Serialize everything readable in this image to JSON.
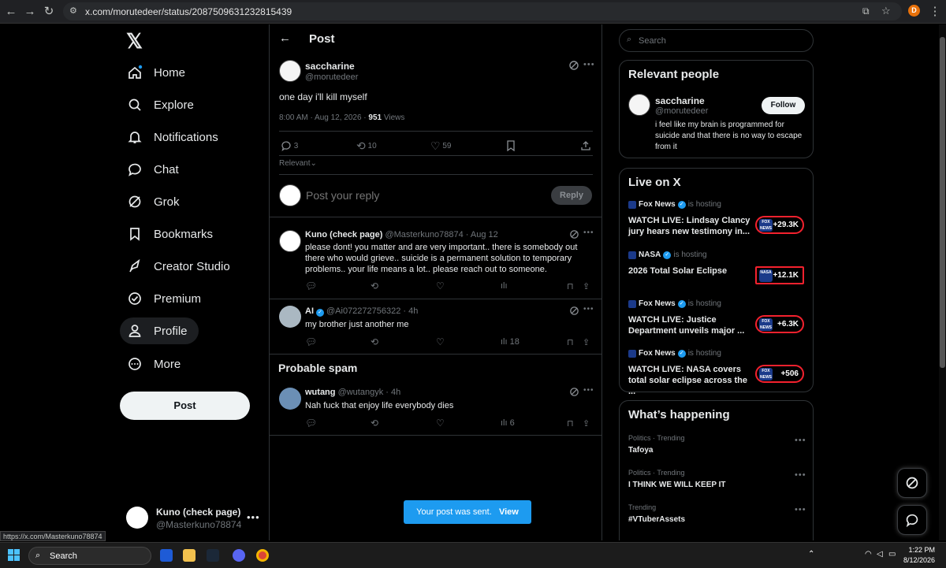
{
  "browser": {
    "url": "x.com/morutedeer/status/2087509631232815439",
    "profile_initial": "D",
    "status_url": "https://x.com/Masterkuno78874"
  },
  "nav": {
    "items": [
      {
        "label": "Home",
        "icon": "home-icon"
      },
      {
        "label": "Explore",
        "icon": "search-icon"
      },
      {
        "label": "Notifications",
        "icon": "bell-icon"
      },
      {
        "label": "Chat",
        "icon": "chat-icon"
      },
      {
        "label": "Grok",
        "icon": "grok-icon"
      },
      {
        "label": "Bookmarks",
        "icon": "bookmark-icon"
      },
      {
        "label": "Creator Studio",
        "icon": "rocket-icon"
      },
      {
        "label": "Premium",
        "icon": "premium-icon"
      },
      {
        "label": "Profile",
        "icon": "person-icon"
      },
      {
        "label": "More",
        "icon": "more-circle-icon"
      }
    ],
    "post_label": "Post",
    "account": {
      "name": "Kuno (check page)",
      "handle": "@Masterkuno78874"
    }
  },
  "main": {
    "header_title": "Post",
    "post": {
      "name": "saccharine",
      "handle": "@morutedeer",
      "text": "one day i'll kill myself",
      "time": "8:00 AM · Aug 12, 2026 · ",
      "views": "951",
      "views_label": " Views",
      "replies": "3",
      "reposts": "10",
      "likes": "59"
    },
    "sort_label": "Relevant",
    "reply_placeholder": "Post your reply",
    "reply_button": "Reply",
    "replies": [
      {
        "name": "Kuno (check page)",
        "handle": "@Masterkuno78874 · Aug 12",
        "text": "please dont! you matter and are very important.. there is somebody out there who would grieve.. suicide is a permanent solution to temporary problems.. your life means a lot.. please reach out to someone.",
        "views": ""
      },
      {
        "name": "AI",
        "handle": "@Ai072272756322 · 4h",
        "text": "my brother just another me",
        "views": "18"
      }
    ],
    "spam_title": "Probable spam",
    "spam": {
      "name": "wutang",
      "handle": "@wutangyk · 4h",
      "text": "Nah fuck that enjoy life everybody dies",
      "views": "6"
    },
    "toast_text": "Your post was sent.",
    "toast_action": "View"
  },
  "right": {
    "search_placeholder": "Search",
    "relevant_title": "Relevant people",
    "person": {
      "name": "saccharine",
      "handle": "@morutedeer",
      "bio": "i feel like my brain is programmed for suicide and that there is no way to escape from it",
      "follow": "Follow"
    },
    "live_title": "Live on X",
    "live": [
      {
        "host": "Fox News",
        "hosting": "is hosting",
        "title": "WATCH LIVE: Lindsay Clancy jury hears new testimony in...",
        "count": "+29.3K",
        "logo": "FOX NEWS"
      },
      {
        "host": "NASA",
        "hosting": "is hosting",
        "title": "2026 Total Solar Eclipse",
        "count": "+12.1K",
        "logo": "NASA"
      },
      {
        "host": "Fox News",
        "hosting": "is hosting",
        "title": "WATCH LIVE: Justice Department unveils major ...",
        "count": "+6.3K",
        "logo": "FOX NEWS"
      },
      {
        "host": "Fox News",
        "hosting": "is hosting",
        "title": "WATCH LIVE: NASA covers total solar eclipse across the ...",
        "count": "+506",
        "logo": "FOX NEWS"
      }
    ],
    "happening_title": "What’s happening",
    "trends": [
      {
        "meta": "Politics · Trending",
        "name": "Tafoya"
      },
      {
        "meta": "Politics · Trending",
        "name": "I THINK WE WILL KEEP IT"
      },
      {
        "meta": "Trending",
        "name": "#VTuberAssets"
      }
    ]
  },
  "taskbar": {
    "search_label": "Search",
    "time": "1:22 PM",
    "date": "8/12/2026"
  }
}
